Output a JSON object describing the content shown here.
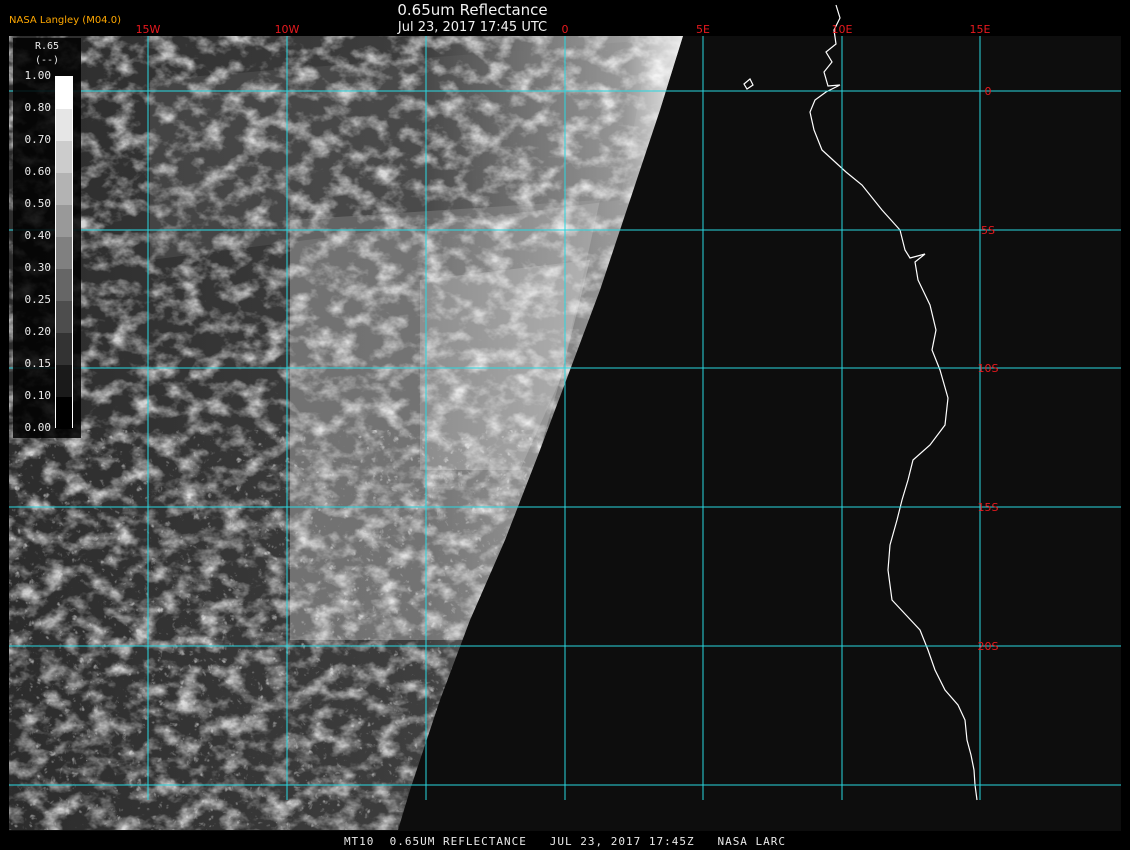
{
  "header": {
    "title": "0.65um Reflectance",
    "datetime": "Jul 23, 2017 17:45 UTC",
    "agency": "NASA Langley (M04.0)"
  },
  "footer": {
    "text": "MT10  0.65UM REFLECTANCE   JUL 23, 2017 17:45Z   NASA LARC"
  },
  "legend": {
    "title": "R.65",
    "units": "(--)",
    "ticks": [
      "1.00",
      "0.80",
      "0.70",
      "0.60",
      "0.50",
      "0.40",
      "0.30",
      "0.25",
      "0.20",
      "0.15",
      "0.10",
      "0.00"
    ]
  },
  "map": {
    "longitude_labels": [
      "15W",
      "10W",
      "0",
      "5E",
      "10E",
      "15E"
    ],
    "latitude_labels": [
      "0",
      "5S",
      "10S",
      "15S",
      "20S"
    ],
    "colors": {
      "gridline": "#29d7e0",
      "grid_label": "#e8191e",
      "coastline": "#ffffff",
      "background": "#000000",
      "space": "#0d0d0d"
    }
  }
}
